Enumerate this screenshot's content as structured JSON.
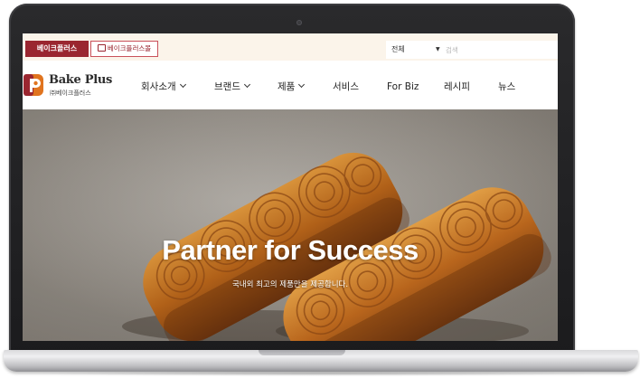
{
  "topbar": {
    "tab_active_label": "베이크플러스",
    "tab_outline_label": "베이크플러스몰",
    "search_category": "전체",
    "search_placeholder": "검색"
  },
  "logo": {
    "name": "Bake Plus",
    "sub": "㈜베이크플러스"
  },
  "nav": [
    {
      "label": "회사소개",
      "dropdown": true
    },
    {
      "label": "브랜드",
      "dropdown": true
    },
    {
      "label": "제품",
      "dropdown": true
    },
    {
      "label": "서비스",
      "dropdown": false
    },
    {
      "label": "For Biz",
      "dropdown": false
    },
    {
      "label": "레시피",
      "dropdown": false
    },
    {
      "label": "뉴스",
      "dropdown": false
    }
  ],
  "hero": {
    "title": "Partner for Success",
    "subtitle": "국내외 최고의 제품만을 제공합니다."
  },
  "colors": {
    "brand_red": "#9a2630",
    "topbar_bg": "#fbf4ea",
    "logo_orange": "#e0741f"
  }
}
